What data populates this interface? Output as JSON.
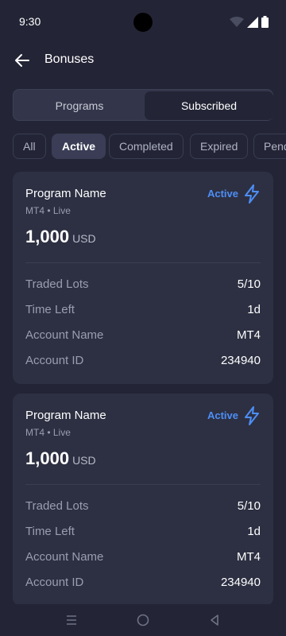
{
  "status_bar": {
    "time": "9:30"
  },
  "header": {
    "title": "Bonuses"
  },
  "segment": {
    "tabs": [
      {
        "label": "Programs"
      },
      {
        "label": "Subscribed"
      }
    ]
  },
  "filters": [
    {
      "label": "All"
    },
    {
      "label": "Active"
    },
    {
      "label": "Completed"
    },
    {
      "label": "Expired"
    },
    {
      "label": "Pending"
    }
  ],
  "cards": [
    {
      "name": "Program Name",
      "subtitle": "MT4 • Live",
      "amount": "1,000",
      "currency": "USD",
      "status": "Active",
      "rows": [
        {
          "label": "Traded Lots",
          "value": "5/10"
        },
        {
          "label": "Time Left",
          "value": "1d"
        },
        {
          "label": "Account Name",
          "value": "MT4"
        },
        {
          "label": "Account ID",
          "value": "234940"
        }
      ]
    },
    {
      "name": "Program Name",
      "subtitle": "MT4 • Live",
      "amount": "1,000",
      "currency": "USD",
      "status": "Active",
      "rows": [
        {
          "label": "Traded Lots",
          "value": "5/10"
        },
        {
          "label": "Time Left",
          "value": "1d"
        },
        {
          "label": "Account Name",
          "value": "MT4"
        },
        {
          "label": "Account ID",
          "value": "234940"
        }
      ]
    }
  ],
  "colors": {
    "background": "#232536",
    "card": "#2d3042",
    "accent": "#4d8ef7"
  },
  "icons": [
    "back-arrow-icon",
    "wifi-icon",
    "signal-icon",
    "battery-icon",
    "bolt-icon",
    "menu-icon",
    "home-icon",
    "back-icon"
  ]
}
